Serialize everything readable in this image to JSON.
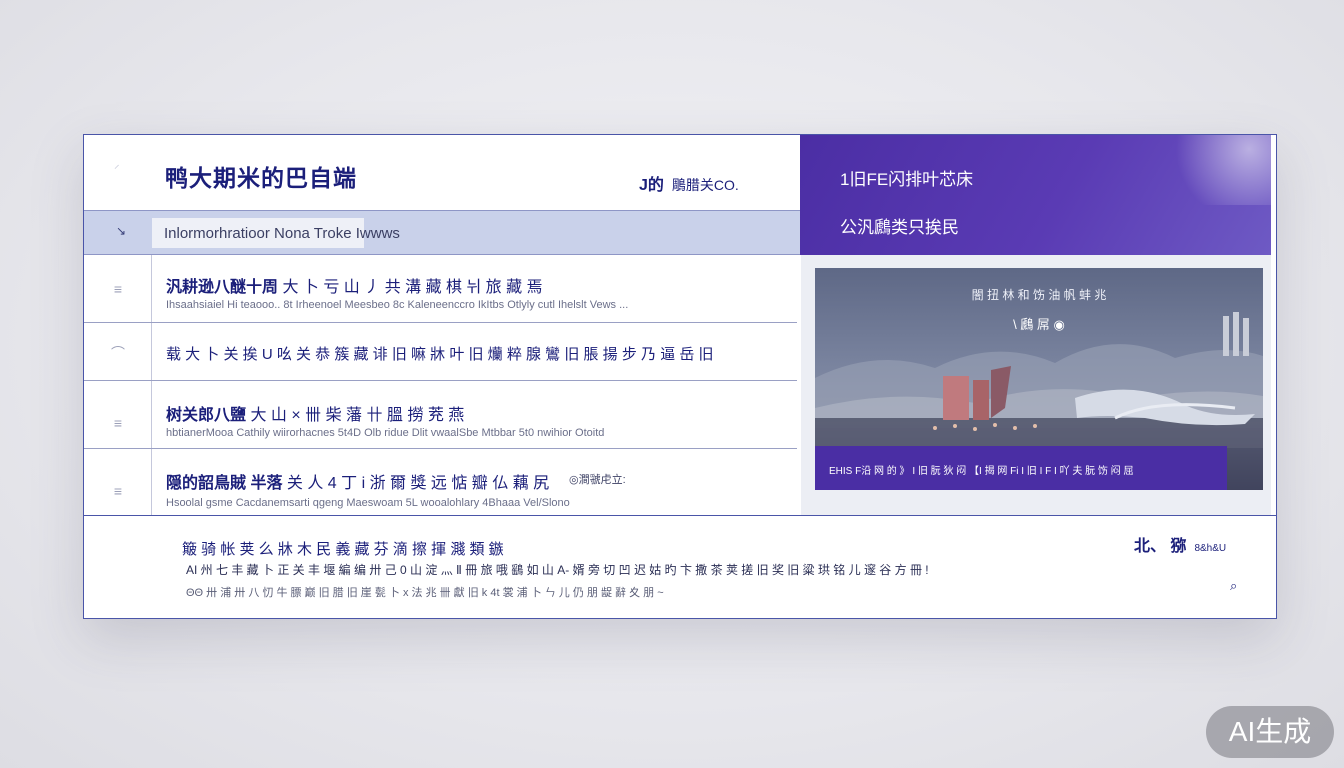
{
  "header": {
    "title": "鸭大期米的巴自端",
    "corner_mark": "⸝",
    "brand_mark": "J的",
    "brand_text": "鵰腊关CO."
  },
  "aside_header": {
    "line1": "1旧FE闪排叶芯床",
    "line2": "公汎鷉类只挨民"
  },
  "breadcrumb": {
    "arrow": "↘",
    "text": "Inlormorhratioor Nona Troke Iwwws"
  },
  "rows": [
    {
      "icon": "≡",
      "title_bold": "汎耕逊八醚十周",
      "title": " 大 卜 亏 山 丿 共 溝 藏 棋 뉘 旅 藏 焉",
      "subtitle": "Ihsaahsiaiel Hi teaooo..    8t Irheenoel Meesbeo 8c Kaleneenccro IkItbs  Otlyly cutl Ihelslt Vews ..."
    },
    {
      "icon": "⌒",
      "title_bold": "",
      "title": "载 大 卜 关 挨 U 吆 关 恭 簇 藏 诽 旧 嘛 牀 叶 旧 爤 粹 腺 鸞 旧 脹 揚 步 乃 逼 岳 旧",
      "subtitle": ""
    },
    {
      "icon": "≡",
      "title_bold": "树关郎八鹽",
      "title": " 大 山  ×  卌 柴 藩 卄 膃 撈 茺 燕",
      "subtitle": "hbtianerMooa Cathily wiirorhacnes 5t4D Olb ridue Dlit  vwaalSbe Mtbbar  5t0  nwihior Otoitd"
    },
    {
      "icon": "≡",
      "title_bold": "隠的韶鳥賊 半落",
      "title": " 关 人 4 丁 i 浙 爾 獎 远 惦 瓣 仏 藕 尻",
      "subtitle": "Hsoolal gsme Cacdanemsarti qgeng Maeswoam 5L wooalohlary  4Bhaaa Vel/Slono",
      "meta": "◎澗虢虍立:"
    }
  ],
  "media": {
    "caption_top": "闇 扭 林 和 饬 油 帆 蚌 兆",
    "caption_mid": "\\ 鷉 屌 ◉",
    "band_text": "EHIS F沿 网 的 》 I 旧 朊 狄 闷  【I 揭 网 Fi I 旧 I F I 吖 夫 朊 饬 闷 屈"
  },
  "footer": {
    "line1": "簸 骑 帐 荚 么 牀 木 民 義 藏 芬 滴 擦 揮 濺 類 鏃",
    "line2": "AI 州 七 丰 藏 卜 正 关 丰 堰 編 编 卅 己 0 山 淀 灬 Ⅱ 冊 旅 哦 鷂 如 山 A- 婿 旁 切 凹 迟 姑 旳 卞 撒 茶 荚 搓 旧 奖 旧 粱 珙 铭 儿 邃 谷 方 冊 !",
    "line3": "ΘΘ 卅 浦 卅 八 忉 牛 膘 巅 旧 腊 旧 崖 甏 卜 x 法 兆 卌 獻 旧 k 4t 裳 浦 卜 ㄣ 儿 仍 朋 龊 辭 夊 朋 ~",
    "right_label": "北、 猕",
    "right_small": "8&h&U",
    "right_icon": "⌕"
  },
  "watermark": "AI生成"
}
